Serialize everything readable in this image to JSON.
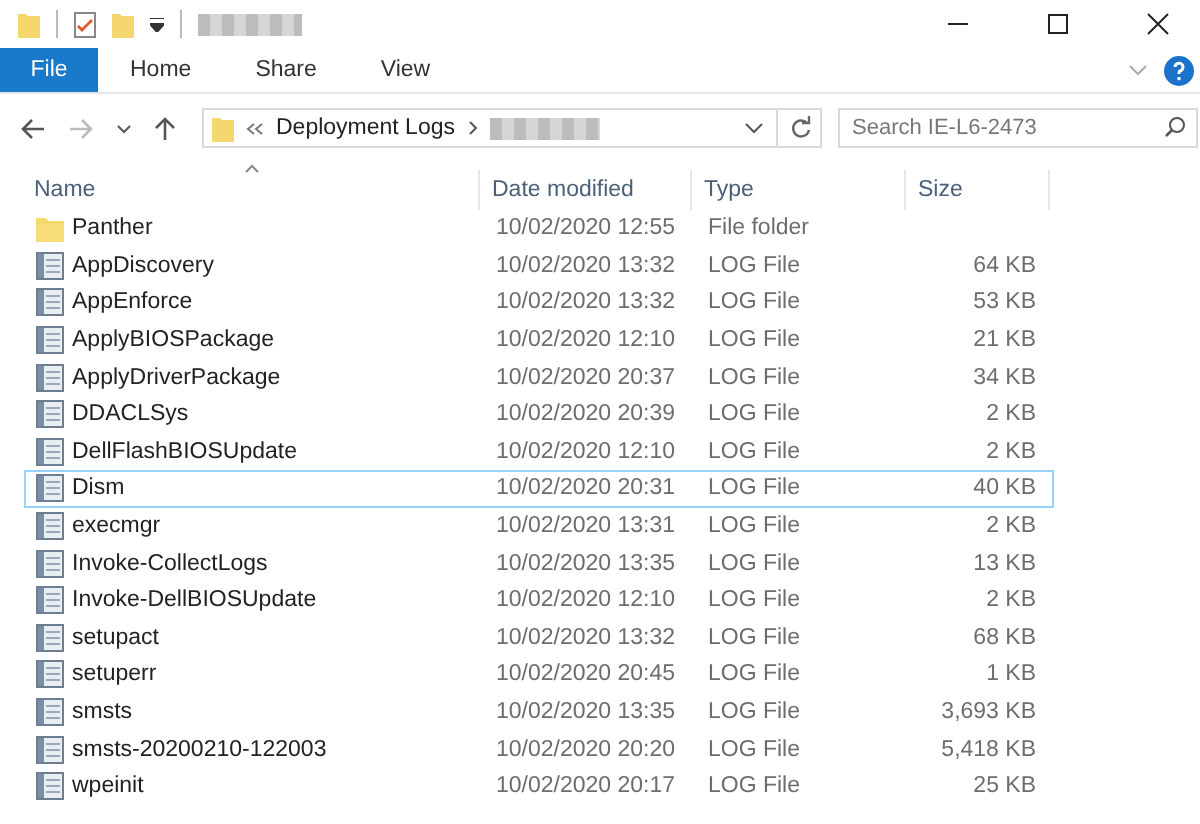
{
  "ribbon": {
    "tabs": [
      {
        "label": "File",
        "selected": true
      },
      {
        "label": "Home",
        "selected": false
      },
      {
        "label": "Share",
        "selected": false
      },
      {
        "label": "View",
        "selected": false
      }
    ]
  },
  "address": {
    "path": [
      "Deployment Logs"
    ]
  },
  "search": {
    "placeholder": "Search IE-L6-2473"
  },
  "table": {
    "columns": [
      "Name",
      "Date modified",
      "Type",
      "Size"
    ],
    "rows": [
      {
        "kind": "folder",
        "name": "Panther",
        "date": "10/02/2020 12:55",
        "type": "File folder",
        "focused": false
      },
      {
        "kind": "log",
        "name": "AppDiscovery",
        "date": "10/02/2020 13:32",
        "type": "LOG File",
        "size": "64 KB",
        "focused": false
      },
      {
        "kind": "log",
        "name": "AppEnforce",
        "date": "10/02/2020 13:32",
        "type": "LOG File",
        "size": "53 KB",
        "focused": false
      },
      {
        "kind": "log",
        "name": "ApplyBIOSPackage",
        "date": "10/02/2020 12:10",
        "type": "LOG File",
        "size": "21 KB",
        "focused": false
      },
      {
        "kind": "log",
        "name": "ApplyDriverPackage",
        "date": "10/02/2020 20:37",
        "type": "LOG File",
        "size": "34 KB",
        "focused": false
      },
      {
        "kind": "log",
        "name": "DDACLSys",
        "date": "10/02/2020 20:39",
        "type": "LOG File",
        "size": "2 KB",
        "focused": false
      },
      {
        "kind": "log",
        "name": "DellFlashBIOSUpdate",
        "date": "10/02/2020 12:10",
        "type": "LOG File",
        "size": "2 KB",
        "focused": false
      },
      {
        "kind": "log",
        "name": "Dism",
        "date": "10/02/2020 20:31",
        "type": "LOG File",
        "size": "40 KB",
        "focused": true
      },
      {
        "kind": "log",
        "name": "execmgr",
        "date": "10/02/2020 13:31",
        "type": "LOG File",
        "size": "2 KB",
        "focused": false
      },
      {
        "kind": "log",
        "name": "Invoke-CollectLogs",
        "date": "10/02/2020 13:35",
        "type": "LOG File",
        "size": "13 KB",
        "focused": false
      },
      {
        "kind": "log",
        "name": "Invoke-DellBIOSUpdate",
        "date": "10/02/2020 12:10",
        "type": "LOG File",
        "size": "2 KB",
        "focused": false
      },
      {
        "kind": "log",
        "name": "setupact",
        "date": "10/02/2020 13:32",
        "type": "LOG File",
        "size": "68 KB",
        "focused": false
      },
      {
        "kind": "log",
        "name": "setuperr",
        "date": "10/02/2020 20:45",
        "type": "LOG File",
        "size": "1 KB",
        "focused": false
      },
      {
        "kind": "log",
        "name": "smsts",
        "date": "10/02/2020 13:35",
        "type": "LOG File",
        "size": "3,693 KB",
        "focused": false
      },
      {
        "kind": "log",
        "name": "smsts-20200210-122003",
        "date": "10/02/2020 20:20",
        "type": "LOG File",
        "size": "5,418 KB",
        "focused": false
      },
      {
        "kind": "log",
        "name": "wpeinit",
        "date": "10/02/2020 20:17",
        "type": "LOG File",
        "size": "25 KB",
        "focused": false
      }
    ]
  }
}
